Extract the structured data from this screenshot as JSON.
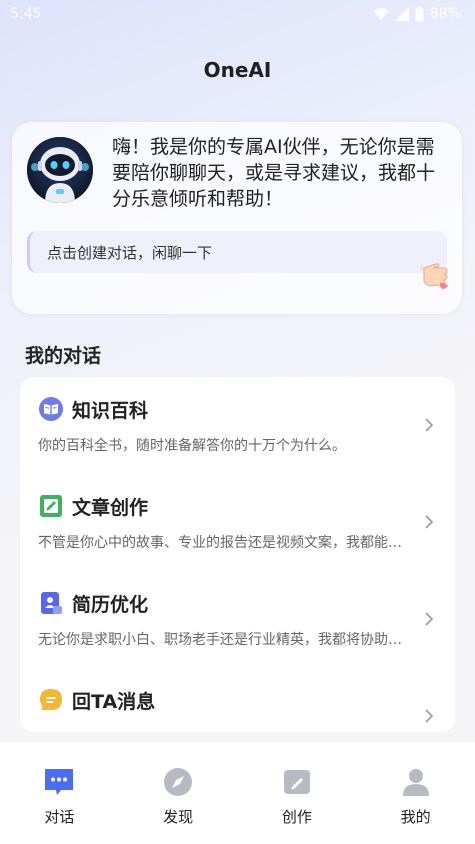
{
  "status_bar": {
    "time": "5:45",
    "battery": "88%"
  },
  "app": {
    "title": "OneAI"
  },
  "hero": {
    "greeting": "嗨！我是你的专属AI伙伴，无论你是需要陪你聊聊天，或是寻求建议，我都十分乐意倾听和帮助！",
    "chat_entry_label": "点击创建对话，闲聊一下"
  },
  "section": {
    "title": "我的对话"
  },
  "conversations": [
    {
      "icon": "book-icon",
      "title": "知识百科",
      "desc": "你的百科全书，随时准备解答你的十万个为什么。"
    },
    {
      "icon": "edit-note-icon",
      "title": "文章创作",
      "desc": "不管是你心中的故事、专业的报告还是视频文案，我都能…"
    },
    {
      "icon": "resume-icon",
      "title": "简历优化",
      "desc": "无论你是求职小白、职场老手还是行业精英，我都将协助…"
    },
    {
      "icon": "message-icon",
      "title": "回TA消息",
      "desc": ""
    }
  ],
  "tabs": [
    {
      "label": "对话",
      "icon": "chat-bubble-icon",
      "active": true
    },
    {
      "label": "发现",
      "icon": "compass-icon",
      "active": false
    },
    {
      "label": "创作",
      "icon": "pen-icon",
      "active": false
    },
    {
      "label": "我的",
      "icon": "user-icon",
      "active": false
    }
  ],
  "colors": {
    "accent": "#4a6cf7",
    "tab_inactive": "#b7bac2",
    "title_text": "#222222"
  }
}
